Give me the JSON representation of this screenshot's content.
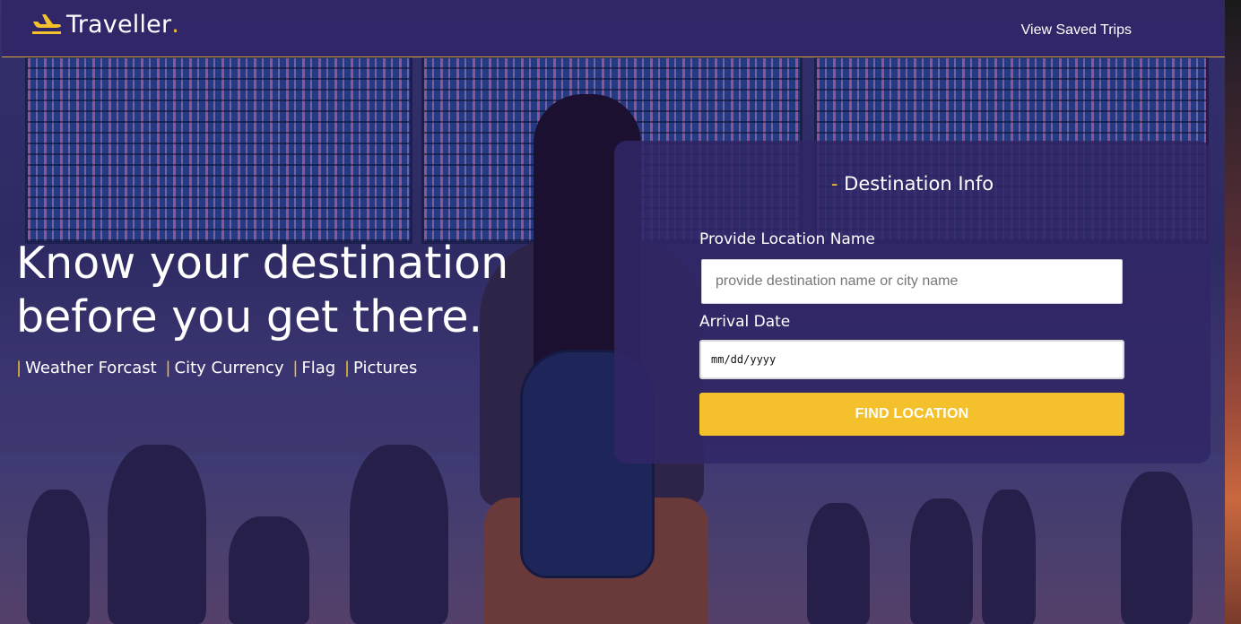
{
  "header": {
    "logo_text": "Traveller",
    "logo_dot": ".",
    "logo_icon": "plane-icon",
    "nav_link": "View Saved Trips"
  },
  "hero": {
    "title": "Know your destination before you get there.",
    "features": [
      "Weather Forcast",
      "City Currency",
      "Flag",
      "Pictures"
    ],
    "separator": "|"
  },
  "form": {
    "title_dash": "-",
    "title": "Destination Info",
    "location_label": "Provide Location Name",
    "location_placeholder": "provide destination name or city name",
    "location_value": "",
    "date_label": "Arrival Date",
    "date_placeholder": "mm/dd/yyyy",
    "submit_label": "FIND LOCATION"
  },
  "colors": {
    "accent": "#f4c12c",
    "header_bg": "#312667",
    "panel_bg": "#312667",
    "text": "#ffffff"
  }
}
